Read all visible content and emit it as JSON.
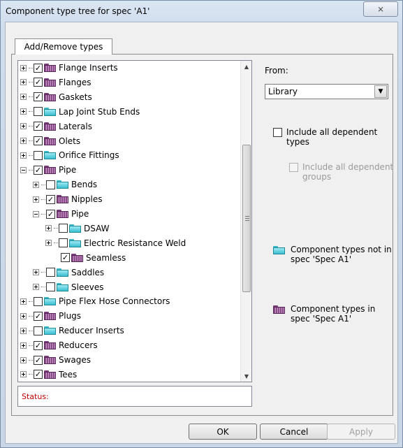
{
  "window": {
    "title": "Component type tree for spec 'A1'",
    "close_glyph": "⨯"
  },
  "tab": {
    "label": "Add/Remove types"
  },
  "tree": {
    "items": [
      {
        "label": "Flange Inserts",
        "level": 0,
        "expander": "plus",
        "checked": true,
        "folder": "purple"
      },
      {
        "label": "Flanges",
        "level": 0,
        "expander": "plus",
        "checked": true,
        "folder": "purple"
      },
      {
        "label": "Gaskets",
        "level": 0,
        "expander": "plus",
        "checked": true,
        "folder": "purple"
      },
      {
        "label": "Lap Joint Stub Ends",
        "level": 0,
        "expander": "plus",
        "checked": false,
        "folder": "cyan"
      },
      {
        "label": "Laterals",
        "level": 0,
        "expander": "plus",
        "checked": true,
        "folder": "purple"
      },
      {
        "label": "Olets",
        "level": 0,
        "expander": "plus",
        "checked": true,
        "folder": "purple"
      },
      {
        "label": "Orifice Fittings",
        "level": 0,
        "expander": "plus",
        "checked": false,
        "folder": "cyan"
      },
      {
        "label": "Pipe",
        "level": 0,
        "expander": "minus",
        "checked": true,
        "folder": "purple"
      },
      {
        "label": "Bends",
        "level": 1,
        "expander": "plus",
        "checked": false,
        "folder": "cyan"
      },
      {
        "label": "Nipples",
        "level": 1,
        "expander": "plus",
        "checked": true,
        "folder": "purple"
      },
      {
        "label": "Pipe",
        "level": 1,
        "expander": "minus",
        "checked": true,
        "folder": "purple"
      },
      {
        "label": "DSAW",
        "level": 2,
        "expander": "plus",
        "checked": false,
        "folder": "cyan"
      },
      {
        "label": "Electric Resistance Weld",
        "level": 2,
        "expander": "plus",
        "checked": false,
        "folder": "cyan"
      },
      {
        "label": "Seamless",
        "level": 2,
        "expander": "none",
        "checked": true,
        "folder": "purple"
      },
      {
        "label": "Saddles",
        "level": 1,
        "expander": "plus",
        "checked": false,
        "folder": "cyan"
      },
      {
        "label": "Sleeves",
        "level": 1,
        "expander": "plus",
        "checked": false,
        "folder": "cyan"
      },
      {
        "label": "Pipe Flex Hose Connectors",
        "level": 0,
        "expander": "plus",
        "checked": false,
        "folder": "cyan"
      },
      {
        "label": "Plugs",
        "level": 0,
        "expander": "plus",
        "checked": true,
        "folder": "purple"
      },
      {
        "label": "Reducer Inserts",
        "level": 0,
        "expander": "plus",
        "checked": false,
        "folder": "cyan"
      },
      {
        "label": "Reducers",
        "level": 0,
        "expander": "plus",
        "checked": true,
        "folder": "purple"
      },
      {
        "label": "Swages",
        "level": 0,
        "expander": "plus",
        "checked": true,
        "folder": "purple"
      },
      {
        "label": "Tees",
        "level": 0,
        "expander": "plus",
        "checked": true,
        "folder": "purple"
      }
    ],
    "scroll_up_glyph": "▲",
    "scroll_down_glyph": "▼"
  },
  "status": {
    "label": "Status:"
  },
  "right_panel": {
    "from_label": "From:",
    "from_value": "Library",
    "dropdown_glyph": "▼",
    "include_dependent_types": "Include all dependent types",
    "include_dependent_groups": "Include all dependent groups",
    "legend_not_in_spec": "Component types not in spec 'Spec A1'",
    "legend_in_spec": "Component types in spec 'Spec A1'"
  },
  "buttons": {
    "ok": "OK",
    "cancel": "Cancel",
    "apply": "Apply"
  },
  "colors": {
    "not_in_spec_folder": "#38bfd1",
    "in_spec_folder": "#8b4b8b",
    "status_text": "#c00000"
  }
}
